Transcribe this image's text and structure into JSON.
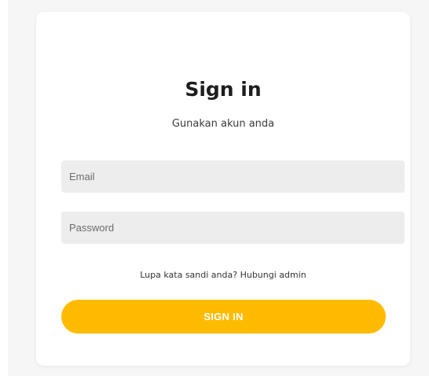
{
  "form": {
    "title": "Sign in",
    "subtitle": "Gunakan akun anda",
    "email_placeholder": "Email",
    "password_placeholder": "Password",
    "forgot_text": "Lupa kata sandi anda? Hubungi admin",
    "submit_label": "SIGN IN"
  },
  "colors": {
    "page_background": "#f6f6f6",
    "card_background": "#ffffff",
    "input_background": "#ededed",
    "accent": "#ffbb00",
    "button_text": "#ffffff"
  }
}
